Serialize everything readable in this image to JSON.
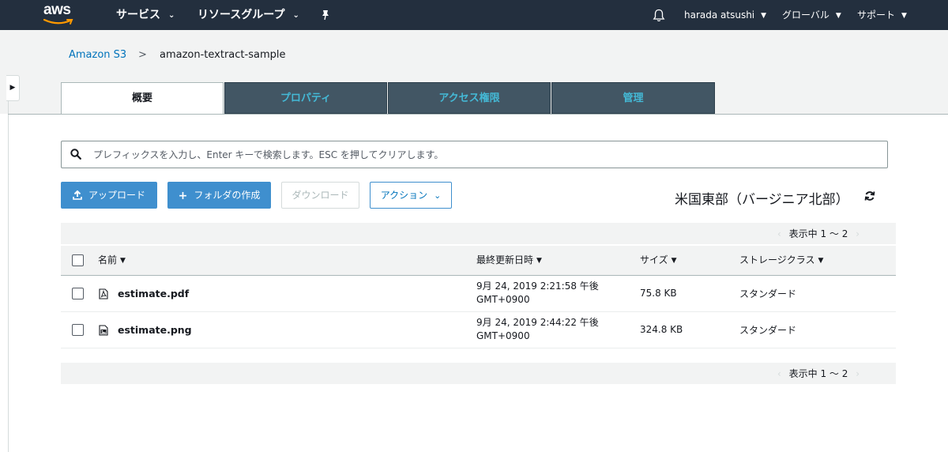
{
  "topnav": {
    "logo_text": "aws",
    "services": "サービス",
    "resource_groups": "リソースグループ",
    "user": "harada atsushi",
    "region": "グローバル",
    "support": "サポート"
  },
  "breadcrumb": {
    "root": "Amazon S3",
    "separator": ">",
    "current": "amazon-textract-sample"
  },
  "tabs": [
    {
      "label": "概要",
      "active": true
    },
    {
      "label": "プロパティ",
      "active": false
    },
    {
      "label": "アクセス権限",
      "active": false
    },
    {
      "label": "管理",
      "active": false
    }
  ],
  "search": {
    "placeholder": "プレフィックスを入力し、Enter キーで検索します。ESC を押してクリアします。"
  },
  "toolbar": {
    "upload": "アップロード",
    "create_folder": "フォルダの作成",
    "download": "ダウンロード",
    "actions": "アクション"
  },
  "region_label": "米国東部（バージニア北部）",
  "pager": {
    "text": "表示中 1 〜 2"
  },
  "table": {
    "headers": {
      "name": "名前",
      "modified": "最終更新日時",
      "size": "サイズ",
      "storage_class": "ストレージクラス"
    },
    "rows": [
      {
        "name": "estimate.pdf",
        "icon": "pdf-file-icon",
        "modified_line1": "9月 24, 2019 2:21:58 午後",
        "modified_line2": "GMT+0900",
        "size": "75.8 KB",
        "storage_class": "スタンダード"
      },
      {
        "name": "estimate.png",
        "icon": "image-file-icon",
        "modified_line1": "9月 24, 2019 2:44:22 午後",
        "modified_line2": "GMT+0900",
        "size": "324.8 KB",
        "storage_class": "スタンダード"
      }
    ]
  },
  "colors": {
    "nav_bg": "#232f3e",
    "tab_inactive_bg": "#425664",
    "tab_inactive_text": "#44b9d6",
    "primary_button": "#3f8fce",
    "link": "#0073bb"
  }
}
